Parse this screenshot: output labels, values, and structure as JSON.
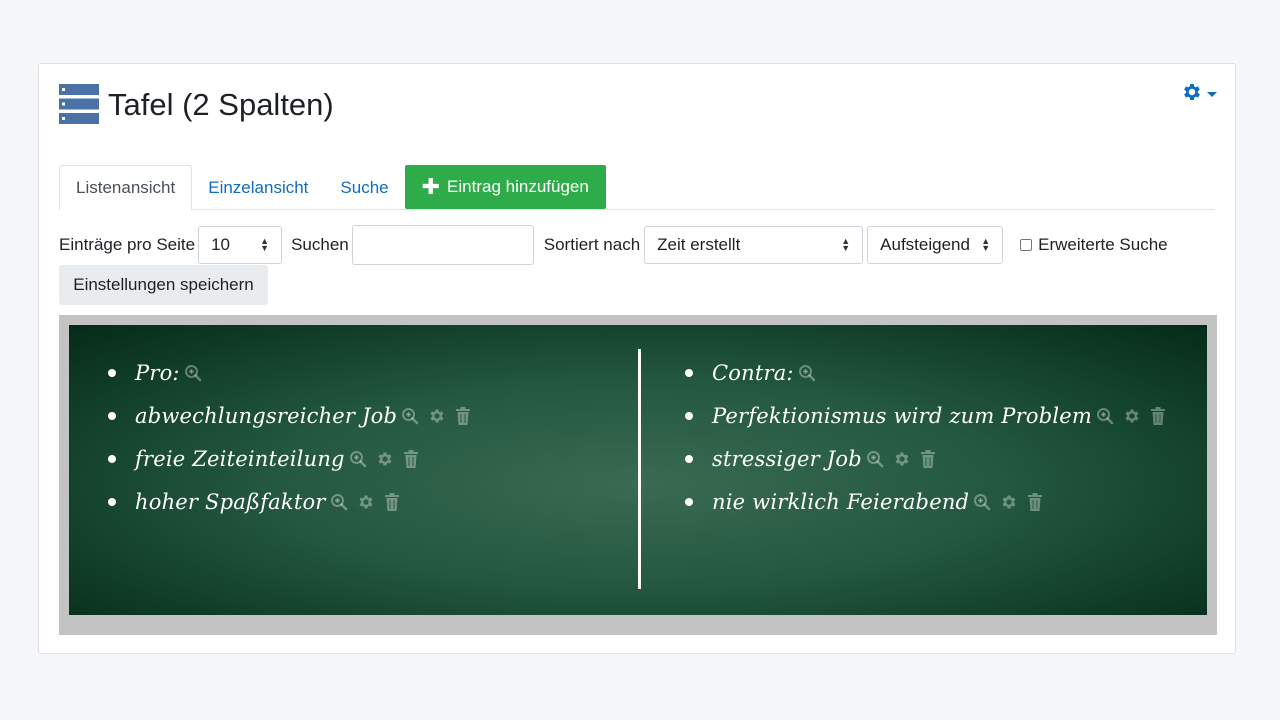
{
  "header": {
    "title": "Tafel (2 Spalten)"
  },
  "tabs": [
    {
      "label": "Listenansicht"
    },
    {
      "label": "Einzelansicht"
    },
    {
      "label": "Suche"
    },
    {
      "label": "Eintrag hinzufügen"
    }
  ],
  "controls": {
    "per_page_label": "Einträge pro Seite",
    "per_page_value": "10",
    "search_label": "Suchen",
    "search_value": "",
    "sort_label": "Sortiert nach",
    "sort_value": "Zeit erstellt",
    "order_value": "Aufsteigend",
    "advanced_search_label": "Erweiterte Suche",
    "advanced_search_checked": false,
    "save_label": "Einstellungen speichern"
  },
  "board": {
    "left": {
      "heading": "Pro:",
      "items": [
        "abwechlungsreicher Job",
        "freie Zeiteinteilung",
        "hoher Spaßfaktor"
      ]
    },
    "right": {
      "heading": "Contra:",
      "items": [
        "Perfektionismus wird zum Problem",
        "stressiger Job",
        "nie wirklich Feierabend"
      ]
    }
  },
  "colors": {
    "accent": "#0f6cbf",
    "icon_blue": "#3d5f8f",
    "add_button": "#2eac4a",
    "board": "#245840"
  },
  "icons": {
    "page_icon": "database-icon",
    "settings": "gear-icon",
    "view": "zoom-in-icon",
    "edit": "gear-icon",
    "delete": "trash-icon"
  }
}
